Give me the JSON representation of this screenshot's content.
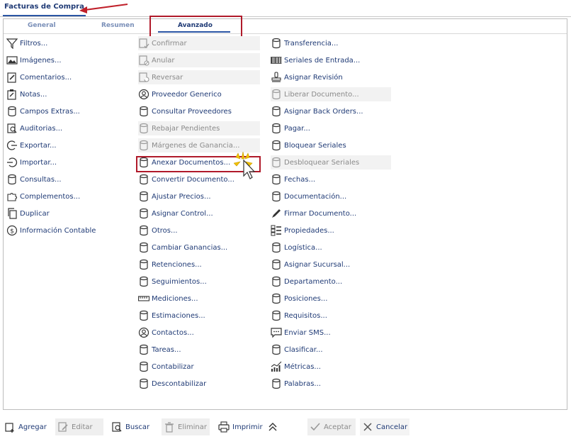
{
  "window": {
    "tab_title": "Facturas de Compra"
  },
  "subtabs": [
    "General",
    "Resumen",
    "Avanzado"
  ],
  "columns": [
    [
      {
        "label": "Filtros...",
        "icon": "filter-icon",
        "disabled": false
      },
      {
        "label": "Imágenes...",
        "icon": "image-icon",
        "disabled": false
      },
      {
        "label": "Comentarios...",
        "icon": "comment-icon",
        "disabled": false
      },
      {
        "label": "Notas...",
        "icon": "note-icon",
        "disabled": false
      },
      {
        "label": "Campos Extras...",
        "icon": "database-icon",
        "disabled": false
      },
      {
        "label": "Auditorias...",
        "icon": "audit-icon",
        "disabled": false
      },
      {
        "label": "Exportar...",
        "icon": "export-icon",
        "disabled": false
      },
      {
        "label": "Importar...",
        "icon": "import-icon",
        "disabled": false
      },
      {
        "label": "Consultas...",
        "icon": "database-icon",
        "disabled": false
      },
      {
        "label": "Complementos...",
        "icon": "puzzle-icon",
        "disabled": false
      },
      {
        "label": "Duplicar",
        "icon": "copy-icon",
        "disabled": false
      },
      {
        "label": "Información Contable",
        "icon": "dollar-icon",
        "disabled": false
      }
    ],
    [
      {
        "label": "Confirmar",
        "icon": "confirm-icon",
        "disabled": true
      },
      {
        "label": "Anular",
        "icon": "cancel-doc-icon",
        "disabled": true
      },
      {
        "label": "Reversar",
        "icon": "reverse-icon",
        "disabled": true
      },
      {
        "label": "Proveedor Generico",
        "icon": "user-icon",
        "disabled": false
      },
      {
        "label": "Consultar Proveedores",
        "icon": "database-icon",
        "disabled": false
      },
      {
        "label": "Rebajar Pendientes",
        "icon": "database-icon",
        "disabled": true
      },
      {
        "label": "Márgenes de Ganancia...",
        "icon": "database-icon",
        "disabled": true
      },
      {
        "label": "Anexar Documentos...",
        "icon": "database-icon",
        "disabled": false
      },
      {
        "label": "Convertir Documento...",
        "icon": "database-icon",
        "disabled": false
      },
      {
        "label": "Ajustar Precios...",
        "icon": "database-icon",
        "disabled": false
      },
      {
        "label": "Asignar Control...",
        "icon": "database-icon",
        "disabled": false
      },
      {
        "label": "Otros...",
        "icon": "database-icon",
        "disabled": false
      },
      {
        "label": "Cambiar Ganancias...",
        "icon": "database-icon",
        "disabled": false
      },
      {
        "label": "Retenciones...",
        "icon": "database-icon",
        "disabled": false
      },
      {
        "label": "Seguimientos...",
        "icon": "database-icon",
        "disabled": false
      },
      {
        "label": "Mediciones...",
        "icon": "ruler-icon",
        "disabled": false
      },
      {
        "label": "Estimaciones...",
        "icon": "database-icon",
        "disabled": false
      },
      {
        "label": "Contactos...",
        "icon": "user-icon",
        "disabled": false
      },
      {
        "label": "Tareas...",
        "icon": "database-icon",
        "disabled": false
      },
      {
        "label": "Contabilizar",
        "icon": "database-icon",
        "disabled": false
      },
      {
        "label": "Descontabilizar",
        "icon": "database-icon",
        "disabled": false
      }
    ],
    [
      {
        "label": "Transferencia...",
        "icon": "database-icon",
        "disabled": false
      },
      {
        "label": "Seriales de Entrada...",
        "icon": "barcode-icon",
        "disabled": false
      },
      {
        "label": "Asignar Revisión",
        "icon": "stamp-icon",
        "disabled": false
      },
      {
        "label": "Liberar Documento...",
        "icon": "database-icon",
        "disabled": true
      },
      {
        "label": "Asignar Back Orders...",
        "icon": "database-icon",
        "disabled": false
      },
      {
        "label": "Pagar...",
        "icon": "database-icon",
        "disabled": false
      },
      {
        "label": "Bloquear Seriales",
        "icon": "database-icon",
        "disabled": false
      },
      {
        "label": "Desbloquear Seriales",
        "icon": "database-icon",
        "disabled": true
      },
      {
        "label": "Fechas...",
        "icon": "database-icon",
        "disabled": false
      },
      {
        "label": "Documentación...",
        "icon": "database-icon",
        "disabled": false
      },
      {
        "label": "Firmar Documento...",
        "icon": "pen-icon",
        "disabled": false
      },
      {
        "label": "Propiedades...",
        "icon": "properties-icon",
        "disabled": false
      },
      {
        "label": "Logística...",
        "icon": "database-icon",
        "disabled": false
      },
      {
        "label": "Asignar Sucursal...",
        "icon": "database-icon",
        "disabled": false
      },
      {
        "label": "Departamento...",
        "icon": "database-icon",
        "disabled": false
      },
      {
        "label": "Posiciones...",
        "icon": "database-icon",
        "disabled": false
      },
      {
        "label": "Requisitos...",
        "icon": "database-icon",
        "disabled": false
      },
      {
        "label": "Enviar SMS...",
        "icon": "sms-icon",
        "disabled": false
      },
      {
        "label": "Clasificar...",
        "icon": "database-icon",
        "disabled": false
      },
      {
        "label": "Métricas...",
        "icon": "metrics-icon",
        "disabled": false
      },
      {
        "label": "Palabras...",
        "icon": "database-icon",
        "disabled": false
      }
    ]
  ],
  "toolbar": {
    "add": "Agregar",
    "edit": "Editar",
    "search": "Buscar",
    "delete": "Eliminar",
    "print": "Imprimir",
    "accept": "Aceptar",
    "cancel": "Cancelar"
  },
  "colors": {
    "text": "#1f3a75",
    "highlight": "#b01a2a",
    "disabled_text": "#8a8a8a"
  }
}
